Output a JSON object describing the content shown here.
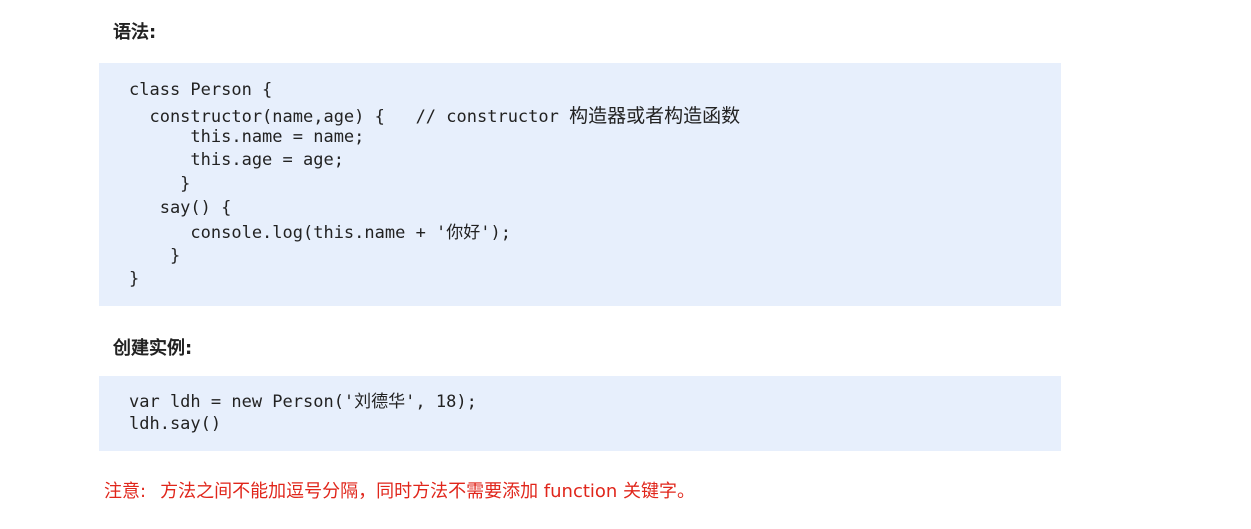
{
  "sections": {
    "syntax": {
      "heading": "语法:",
      "code_lines": [
        "class Person {",
        "  constructor(name,age) {   // constructor ",
        "      this.name = name;",
        "      this.age = age;",
        "     }",
        "   say() {",
        "      console.log(this.name + '你好');",
        "    }",
        "}"
      ],
      "comment_text": "构造器或者构造函数"
    },
    "instance": {
      "heading": "创建实例:",
      "code_lines": [
        "var ldh = new Person('刘德华', 18);",
        "ldh.say()"
      ]
    }
  },
  "note": {
    "label": "注意:",
    "text": "方法之间不能加逗号分隔，同时方法不需要添加 function 关键字。"
  },
  "colors": {
    "code_background": "#e7effc",
    "note_text": "#e0261b",
    "body_text": "#222222"
  }
}
